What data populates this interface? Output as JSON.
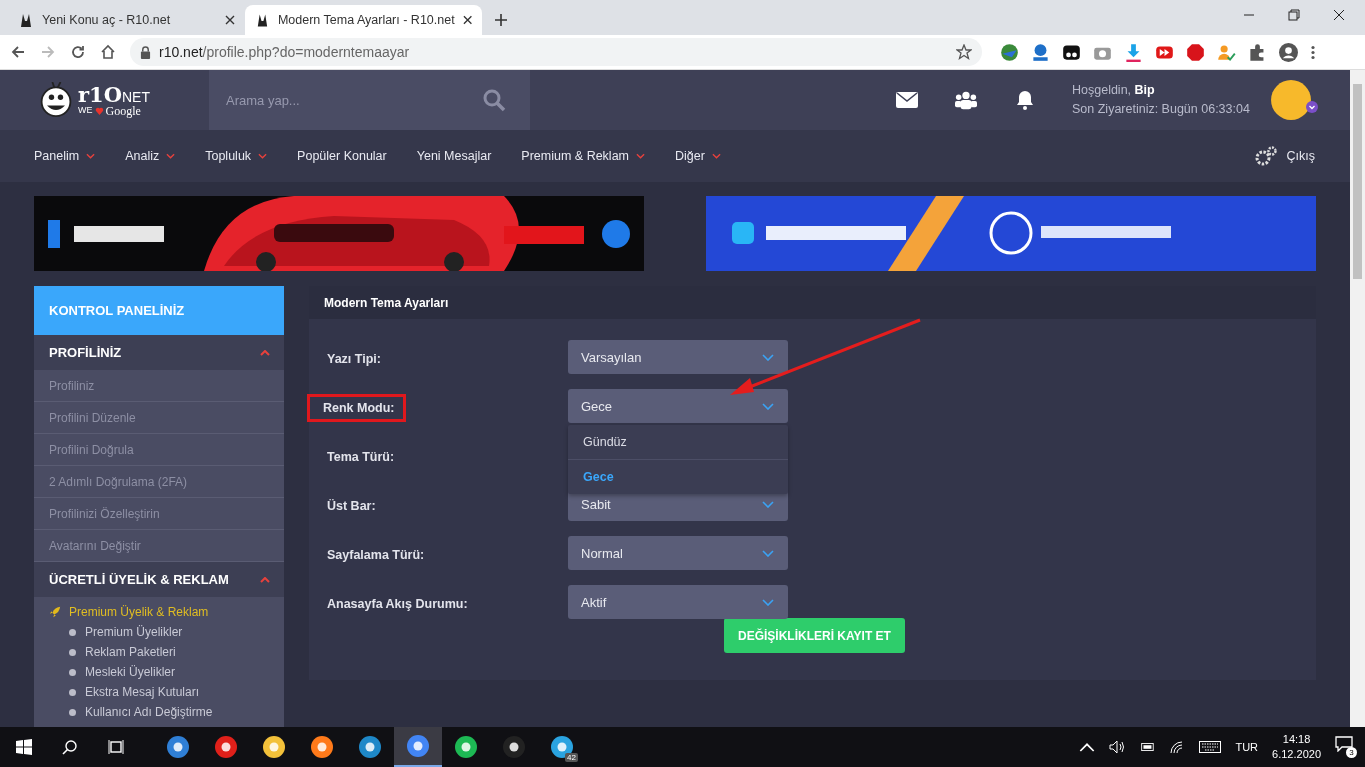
{
  "browser": {
    "tabs": [
      {
        "title": "Yeni Konu aç - R10.net",
        "selected": false
      },
      {
        "title": "Modern Tema Ayarları - R10.net",
        "selected": true
      }
    ],
    "url_host": "r10.net",
    "url_path": "/profile.php?do=moderntemaayar"
  },
  "header": {
    "logo": {
      "brand": "r1O",
      "suffix": "NET",
      "tag_left": "WE",
      "tag_right": "Google"
    },
    "search": {
      "placeholder": "Arama yap..."
    },
    "greeting": "Hoşgeldin, **Bip**",
    "last_visit": "Son Ziyaretiniz: Bugün 06:33:04"
  },
  "nav": {
    "items": [
      {
        "label": "Panelim",
        "has_menu": true
      },
      {
        "label": "Analiz",
        "has_menu": true
      },
      {
        "label": "Topluluk",
        "has_menu": true
      },
      {
        "label": "Popüler Konular",
        "has_menu": false
      },
      {
        "label": "Yeni Mesajlar",
        "has_menu": false
      },
      {
        "label": "Premium & Reklam",
        "has_menu": true
      },
      {
        "label": "Diğer",
        "has_menu": true
      }
    ],
    "logout": "Çıkış"
  },
  "sidebar": {
    "title": "KONTROL PANELİNİZ",
    "sections": [
      {
        "title": "PROFİLİNİZ",
        "expanded": true,
        "items": [
          "Profiliniz",
          "Profilini Düzenle",
          "Profilini Doğrula",
          "2 Adımlı Doğrulama (2FA)",
          "Profilinizi Özelleştirin",
          "Avatarını Değiştir"
        ]
      },
      {
        "title": "ÜCRETLİ ÜYELİK & REKLAM",
        "expanded": true,
        "group": {
          "title": "Premium Üyelik & Reklam",
          "children": [
            "Premium Üyelikler",
            "Reklam Paketleri",
            "Mesleki Üyelikler",
            "Ekstra Mesaj Kutuları",
            "Kullanıcı Adı Değiştirme"
          ]
        }
      }
    ]
  },
  "panel": {
    "title": "Modern Tema Ayarları",
    "fields": [
      {
        "label": "Yazı Tipi:",
        "value": "Varsayılan",
        "highlighted": false
      },
      {
        "label": "Renk Modu:",
        "value": "Gece",
        "highlighted": true,
        "options": [
          {
            "label": "Gündüz",
            "selected": false
          },
          {
            "label": "Gece",
            "selected": true
          }
        ]
      },
      {
        "label": "Tema Türü:",
        "highlighted": false
      },
      {
        "label": "Üst Bar:",
        "value": "Sabit",
        "highlighted": false
      },
      {
        "label": "Sayfalama Türü:",
        "value": "Normal",
        "highlighted": false
      },
      {
        "label": "Anasayfa Akış Durumu:",
        "value": "Aktif",
        "highlighted": false
      }
    ],
    "save_button": "DEĞİŞİKLİKLERİ KAYIT ET"
  },
  "taskbar": {
    "apps": [
      {
        "selected": false
      },
      {
        "selected": false
      },
      {
        "selected": false
      },
      {
        "selected": false
      },
      {
        "selected": false
      },
      {
        "selected": true
      },
      {
        "selected": false
      },
      {
        "selected": false
      },
      {
        "selected": false,
        "badge": "42"
      }
    ],
    "language": "TUR",
    "time": "14:18",
    "date": "6.12.2020",
    "notifications": "3"
  }
}
